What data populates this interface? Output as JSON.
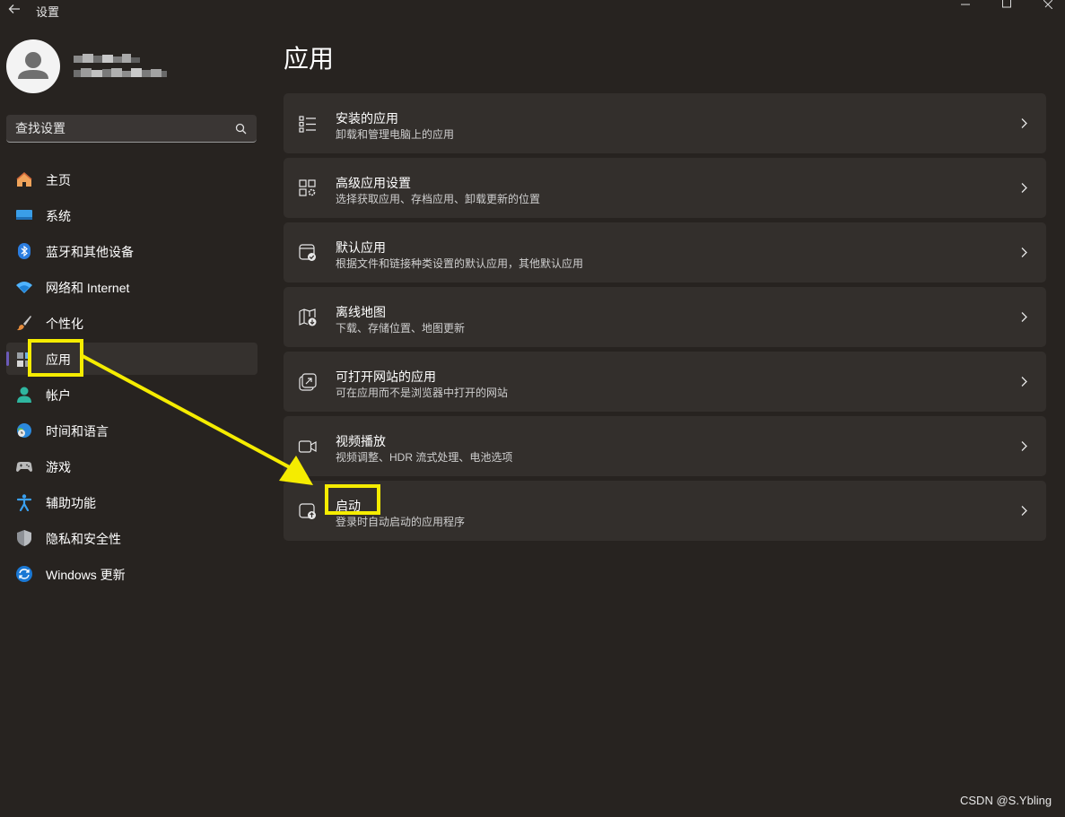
{
  "window": {
    "title": "设置"
  },
  "search": {
    "placeholder": "查找设置"
  },
  "nav": {
    "items": [
      {
        "label": "主页"
      },
      {
        "label": "系统"
      },
      {
        "label": "蓝牙和其他设备"
      },
      {
        "label": "网络和 Internet"
      },
      {
        "label": "个性化"
      },
      {
        "label": "应用"
      },
      {
        "label": "帐户"
      },
      {
        "label": "时间和语言"
      },
      {
        "label": "游戏"
      },
      {
        "label": "辅助功能"
      },
      {
        "label": "隐私和安全性"
      },
      {
        "label": "Windows 更新"
      }
    ],
    "active": "应用"
  },
  "main": {
    "title": "应用",
    "cards": [
      {
        "title": "安装的应用",
        "subtitle": "卸载和管理电脑上的应用",
        "icon": "list-icon"
      },
      {
        "title": "高级应用设置",
        "subtitle": "选择获取应用、存档应用、卸载更新的位置",
        "icon": "grid-gear-icon"
      },
      {
        "title": "默认应用",
        "subtitle": "根据文件和链接种类设置的默认应用，其他默认应用",
        "icon": "window-check-icon"
      },
      {
        "title": "离线地图",
        "subtitle": "下载、存储位置、地图更新",
        "icon": "map-download-icon"
      },
      {
        "title": "可打开网站的应用",
        "subtitle": "可在应用而不是浏览器中打开的网站",
        "icon": "open-external-icon"
      },
      {
        "title": "视频播放",
        "subtitle": "视频调整、HDR 流式处理、电池选项",
        "icon": "video-camera-icon"
      },
      {
        "title": "启动",
        "subtitle": "登录时自动启动的应用程序",
        "icon": "startup-icon"
      }
    ]
  },
  "watermark": "CSDN @S.Ybling",
  "colors": {
    "background": "#272320",
    "card": "#332f2c",
    "annotation": "#f5ec00",
    "accent": "#6b5ab8"
  }
}
